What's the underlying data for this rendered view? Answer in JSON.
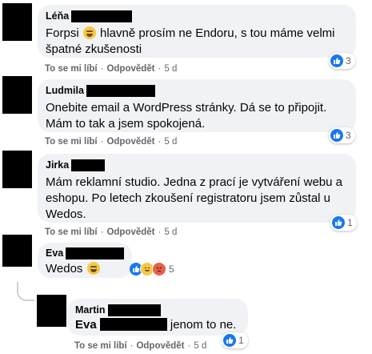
{
  "comments": [
    {
      "author": "Léňa",
      "text_before": "Forpsi ",
      "text_after": " hlavně prosím ne Endoru, s tou máme velmi špatné zkušenosti",
      "actions": {
        "like": "To se mi líbí",
        "reply": "Odpovědět",
        "time": "5 d"
      },
      "reactions": {
        "icon": "like-icon",
        "count": "3"
      }
    },
    {
      "author": "Ludmila",
      "text": "Onebite email a WordPress stránky. Dá se to připojit. Mám to tak a jsem spokojená.",
      "actions": {
        "like": "To se mi líbí",
        "reply": "Odpovědět",
        "time": "5 d"
      },
      "reactions": {
        "icon": "like-icon",
        "count": "3"
      }
    },
    {
      "author": "Jirka",
      "text": "Mám reklamní studio. Jedna z prací je vytváření webu a eshopu. Po letech zkoušení registratoru jsem zůstal u Wedos.",
      "actions": {
        "like": "To se mi líbí",
        "reply": "Odpovědět",
        "time": "5 d"
      },
      "reactions": {
        "icon": "like-icon",
        "count": "1"
      }
    },
    {
      "author": "Eva",
      "text_before": "Wedos ",
      "reactions": {
        "icons": [
          "like-icon",
          "haha-icon",
          "angry-icon"
        ],
        "count": "5"
      }
    }
  ],
  "reply": {
    "author": "Martin",
    "mention": "Eva",
    "text_after": " jenom to ne.",
    "actions": {
      "like": "To se mi líbí",
      "reply": "Odpovědět",
      "time": "5 d"
    },
    "reactions": {
      "icon": "like-icon",
      "count": "1"
    }
  },
  "colors": {
    "bubble": "#f0f2f5",
    "like": "#1877f2",
    "meta": "#65676b"
  }
}
